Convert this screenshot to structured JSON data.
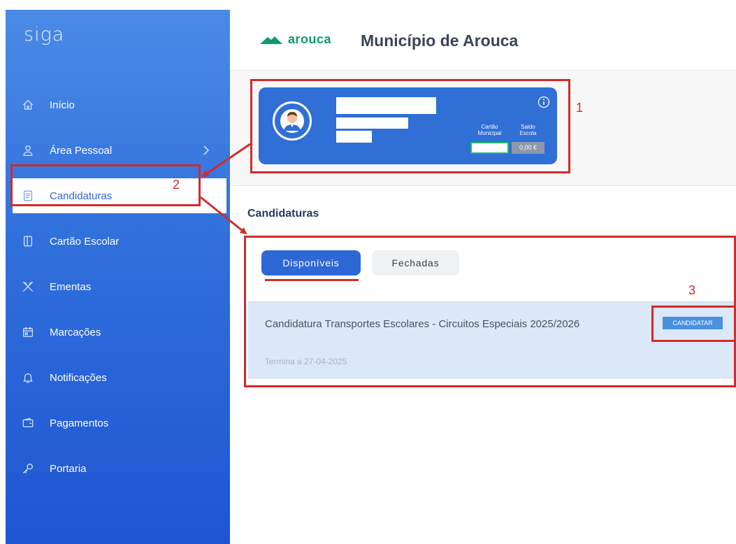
{
  "sidebar": {
    "brand": "siga",
    "items": [
      {
        "label": "Início",
        "icon": "home-icon"
      },
      {
        "label": "Área Pessoal",
        "icon": "user-icon"
      },
      {
        "label": "Candidaturas",
        "icon": "document-icon",
        "active": true
      },
      {
        "label": "Cartão Escolar",
        "icon": "card-icon"
      },
      {
        "label": "Ementas",
        "icon": "utensils-icon"
      },
      {
        "label": "Marcações",
        "icon": "calendar-icon"
      },
      {
        "label": "Notificações",
        "icon": "bell-icon"
      },
      {
        "label": "Pagamentos",
        "icon": "wallet-icon"
      },
      {
        "label": "Portaria",
        "icon": "key-icon"
      }
    ]
  },
  "header": {
    "logo_text": "arouca",
    "title": "Município de Arouca"
  },
  "profile": {
    "cartao_label_1": "Cartão",
    "cartao_label_2": "Municipal",
    "saldo_label_1": "Saldo",
    "saldo_label_2": "Escola",
    "saldo_value": "0,00 €"
  },
  "main": {
    "section_title": "Candidaturas",
    "tabs": [
      {
        "label": "Disponíveis",
        "active": true
      },
      {
        "label": "Fechadas",
        "active": false
      }
    ],
    "list": [
      {
        "title": "Candidatura Transportes Escolares - Circuitos Especiais 2025/2026",
        "deadline": "Termina a 27-04-2025",
        "action": "CANDIDATAR"
      }
    ]
  },
  "annotations": {
    "one": "1",
    "two": "2",
    "three": "3"
  },
  "colors": {
    "sidebar_top": "#4a8be6",
    "sidebar_bottom": "#1f55d2",
    "accent": "#2e67d6",
    "brand_green": "#0f9b6a",
    "annotation_red": "#d42a2a"
  }
}
